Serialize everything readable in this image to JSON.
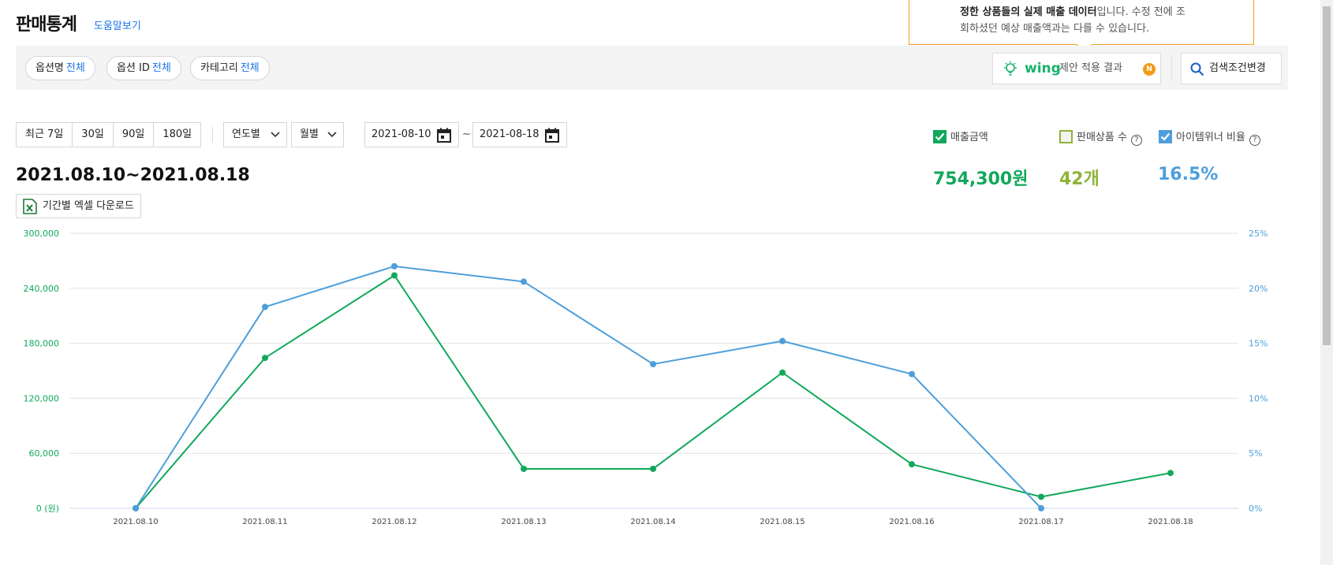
{
  "header": {
    "title": "판매통계",
    "help_link": "도움말보기"
  },
  "tooltip": {
    "bold": "정한 상품들의 실제 매출 데이터",
    "rest1": "입니다. 수정 전에 조",
    "line2": "회하셨던 예상 매출액과는 다를 수 있습니다."
  },
  "filters": {
    "option_name": {
      "label": "옵션명",
      "value": "전체"
    },
    "option_id": {
      "label": "옵션 ID",
      "value": "전체"
    },
    "category": {
      "label": "카테고리",
      "value": "전체"
    },
    "wing_brand": "wing",
    "wing_label": "제안 적용 결과",
    "wing_badge": "N",
    "search_change": "검색조건변경"
  },
  "period": {
    "buttons": [
      "최근 7일",
      "30일",
      "90일",
      "180일"
    ],
    "year_select": "연도별",
    "month_select": "월별",
    "start_date": "2021-08-10",
    "end_date": "2021-08-18",
    "tilde": "~"
  },
  "legend": {
    "sales": {
      "label": "매출금액",
      "checked": true,
      "color": "#11a85b"
    },
    "items": {
      "label": "판매상품 수",
      "checked": false,
      "color": "#8fb339"
    },
    "winner": {
      "label": "아이템위너 비율",
      "checked": true,
      "color": "#4d9fdb"
    }
  },
  "summary": {
    "range": "2021.08.10~2021.08.18",
    "sales_total": "754,300원",
    "items_total": "42개",
    "winner_ratio": "16.5%",
    "excel_download": "기간별 엑셀 다운로드"
  },
  "chart_data": {
    "type": "line",
    "categories": [
      "2021.08.10",
      "2021.08.11",
      "2021.08.12",
      "2021.08.13",
      "2021.08.14",
      "2021.08.15",
      "2021.08.16",
      "2021.08.17",
      "2021.08.18"
    ],
    "series": [
      {
        "name": "매출금액",
        "axis": "left",
        "color": "#11a85b",
        "values": [
          0,
          164000,
          254000,
          43000,
          43000,
          148000,
          48000,
          12500,
          38500
        ]
      },
      {
        "name": "아이템위너 비율",
        "axis": "right",
        "color": "#4d9fdb",
        "values": [
          0,
          18.3,
          22.0,
          20.6,
          13.1,
          15.2,
          12.2,
          0,
          null
        ]
      }
    ],
    "y_left": {
      "ticks": [
        "0 (원)",
        "60,000",
        "120,000",
        "180,000",
        "240,000",
        "300,000"
      ],
      "ylim": [
        0,
        300000
      ],
      "color": "#11a85b"
    },
    "y_right": {
      "ticks": [
        "0%",
        "5%",
        "10%",
        "15%",
        "20%",
        "25%"
      ],
      "ylim": [
        0,
        25
      ],
      "color": "#4d9fdb"
    },
    "grid": true
  }
}
